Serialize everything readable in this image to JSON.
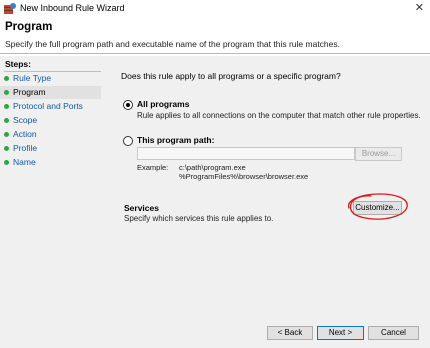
{
  "window": {
    "title": "New Inbound Rule Wizard",
    "close_glyph": "✕"
  },
  "header": {
    "title": "Program",
    "description": "Specify the full program path and executable name of the program that this rule matches."
  },
  "sidebar": {
    "steps_label": "Steps:",
    "items": [
      {
        "label": "Rule Type",
        "active": false
      },
      {
        "label": "Program",
        "active": true
      },
      {
        "label": "Protocol and Ports",
        "active": false
      },
      {
        "label": "Scope",
        "active": false
      },
      {
        "label": "Action",
        "active": false
      },
      {
        "label": "Profile",
        "active": false
      },
      {
        "label": "Name",
        "active": false
      }
    ]
  },
  "main": {
    "question": "Does this rule apply to all programs or a specific program?",
    "all_programs": {
      "label": "All programs",
      "description": "Rule applies to all connections on the computer that match other rule properties.",
      "selected": true
    },
    "this_program": {
      "label": "This program path:",
      "selected": false,
      "value": "",
      "browse_label": "Browse..."
    },
    "example": {
      "label": "Example:",
      "lines": [
        "c:\\path\\program.exe",
        "%ProgramFiles%\\browser\\browser.exe"
      ]
    },
    "services": {
      "title": "Services",
      "description": "Specify which services this rule applies to.",
      "customize_label": "Customize..."
    }
  },
  "footer": {
    "back_label": "< Back",
    "next_label": "Next >",
    "cancel_label": "Cancel"
  },
  "colors": {
    "annotation": "#d41e1e",
    "step_dot": "#2ca640",
    "link": "#0f5ba6",
    "accent": "#0078d7"
  }
}
